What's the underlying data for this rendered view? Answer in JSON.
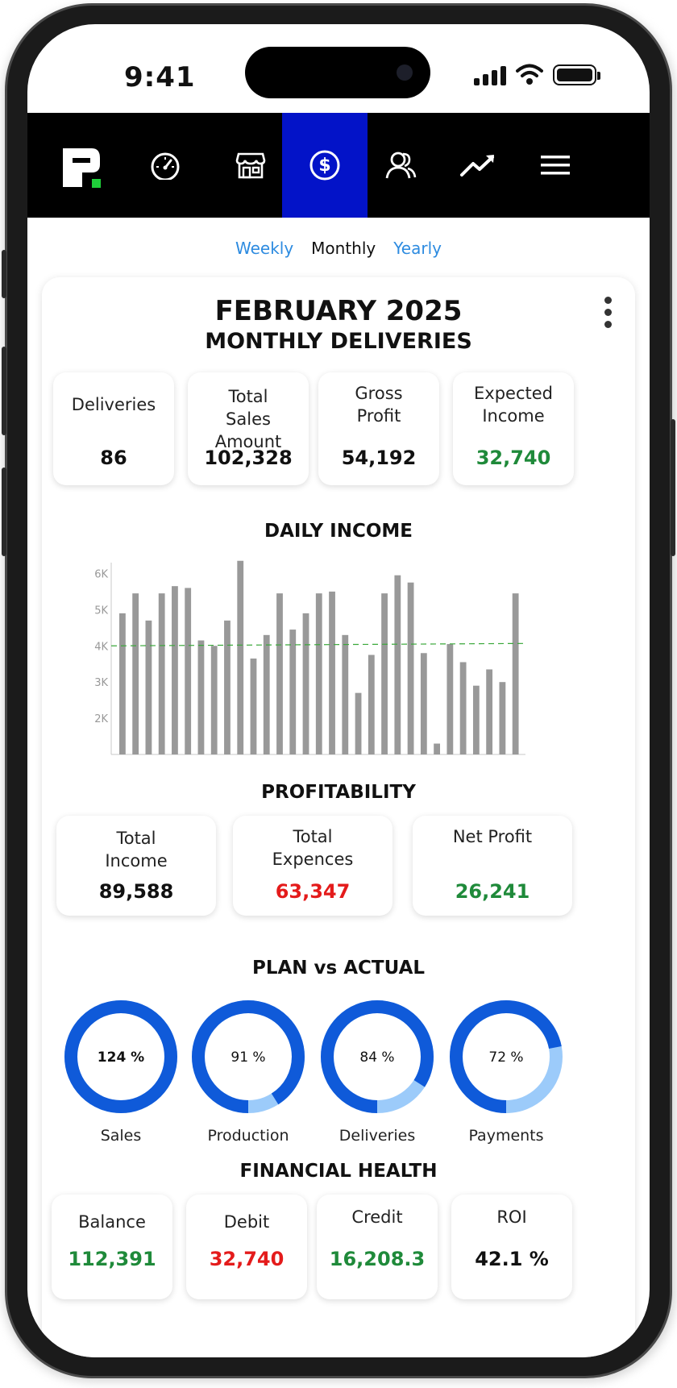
{
  "status_bar": {
    "time": "9:41"
  },
  "nav": {
    "items": [
      {
        "icon": "gauge-icon"
      },
      {
        "icon": "store-icon"
      },
      {
        "icon": "dollar-icon",
        "active": true
      },
      {
        "icon": "users-icon"
      },
      {
        "icon": "trend-up-icon"
      },
      {
        "icon": "hamburger-menu-icon"
      }
    ],
    "active_color": "#0313c8"
  },
  "period": {
    "options": [
      "Weekly",
      "Monthly",
      "Yearly"
    ],
    "selected": "Monthly"
  },
  "report": {
    "title": "FEBRUARY 2025",
    "subtitle": "MONTHLY DELIVERIES",
    "kpis": [
      {
        "label": "Deliveries",
        "value": "86"
      },
      {
        "label": "Total Sales Amount",
        "value": "102,328"
      },
      {
        "label": "Gross Profit",
        "value": "54,192"
      },
      {
        "label": "Expected Income",
        "value": "32,740"
      }
    ]
  },
  "chart_data": {
    "type": "bar",
    "title": "DAILY INCOME",
    "xlabel": "",
    "ylabel": "",
    "ylim": [
      1000,
      6300
    ],
    "y_ticks": [
      {
        "value": 2000,
        "label": "2K"
      },
      {
        "value": 3000,
        "label": "3K"
      },
      {
        "value": 4000,
        "label": "4K"
      },
      {
        "value": 5000,
        "label": "5K"
      },
      {
        "value": 6000,
        "label": "6K"
      }
    ],
    "values": [
      4900,
      5450,
      4700,
      5450,
      5650,
      5600,
      4150,
      4000,
      4700,
      6350,
      3650,
      4300,
      5450,
      4450,
      4900,
      5450,
      5500,
      4300,
      2700,
      3750,
      5450,
      5950,
      5750,
      3800,
      1300,
      4050,
      3550,
      2900,
      3350,
      3000,
      5450
    ],
    "reference_line": {
      "value": 4000,
      "style": "dashed",
      "color": "#3aa83a"
    },
    "bar_color": "#999999"
  },
  "profitability": {
    "title": "PROFITABILITY",
    "items": [
      {
        "label": "Total Income",
        "value": "89,588"
      },
      {
        "label": "Total Expences",
        "value": "63,347"
      },
      {
        "label": "Net Profit",
        "value": "26,241"
      }
    ]
  },
  "plan_vs_actual": {
    "title": "PLAN vs ACTUAL",
    "items": [
      {
        "label": "Sales",
        "value": 124,
        "text": "124 %"
      },
      {
        "label": "Production",
        "value": 91,
        "text": "91 %"
      },
      {
        "label": "Deliveries",
        "value": 84,
        "text": "84 %"
      },
      {
        "label": "Payments",
        "value": 72,
        "text": "72 %"
      }
    ],
    "ring_color": "#0f5ad9",
    "remainder_color": "#9ccbfa"
  },
  "financial_health": {
    "title": "FINANCIAL HEALTH",
    "items": [
      {
        "label": "Balance",
        "value": "112,391"
      },
      {
        "label": "Debit",
        "value": "32,740"
      },
      {
        "label": "Credit",
        "value": "16,208.3"
      },
      {
        "label": "ROI",
        "value": "42.1 %"
      }
    ]
  }
}
